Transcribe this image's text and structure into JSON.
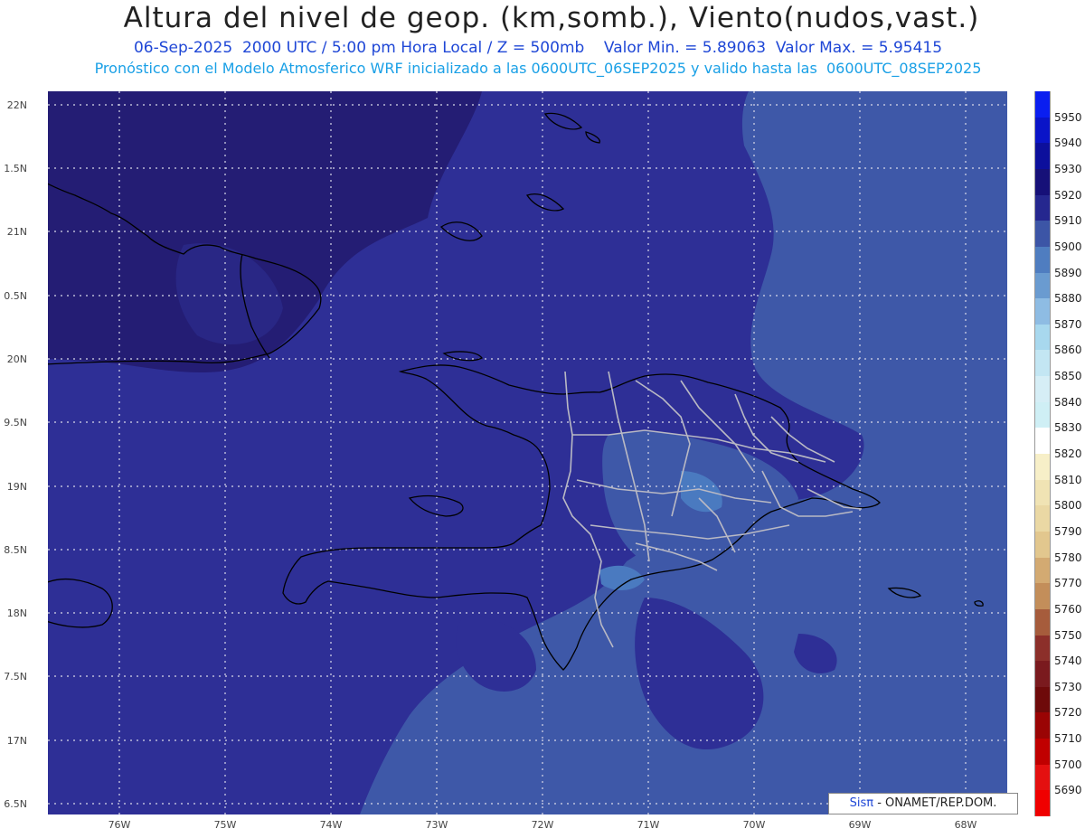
{
  "title": "Altura del nivel de geop. (km,somb.), Viento(nudos,vast.)",
  "subtitle_line1": "06-Sep-2025  2000 UTC / 5:00 pm Hora Local / Z = 500mb    Valor Min. = 5.89063  Valor Max. = 5.95415",
  "subtitle_line2": "Pronóstico con el Modelo Atmosferico WRF inicializado a las 0600UTC_06SEP2025 y valido hasta las  0600UTC_08SEP2025",
  "y_axis_labels": [
    "22N",
    "1.5N",
    "21N",
    "0.5N",
    "20N",
    "9.5N",
    "19N",
    "8.5N",
    "18N",
    "7.5N",
    "17N",
    "6.5N"
  ],
  "x_axis_labels": [
    "76W",
    "75W",
    "74W",
    "73W",
    "72W",
    "71W",
    "70W",
    "69W",
    "68W"
  ],
  "credit": {
    "brand": "Sisπ",
    "text": " - ONAMET/REP.DOM."
  },
  "colorbar": {
    "labels": [
      "5950",
      "5940",
      "5930",
      "5920",
      "5910",
      "5900",
      "5890",
      "5880",
      "5870",
      "5860",
      "5850",
      "5840",
      "5830",
      "5820",
      "5810",
      "5800",
      "5790",
      "5780",
      "5770",
      "5760",
      "5750",
      "5740",
      "5730",
      "5720",
      "5710",
      "5700",
      "5690"
    ],
    "colors": [
      "#0a1ef0",
      "#0a14c8",
      "#0c0f9c",
      "#161078",
      "#25278f",
      "#3c55a6",
      "#4f7dc0",
      "#6a9bd0",
      "#8ebce3",
      "#a8d8ee",
      "#c3e6f3",
      "#d6eef6",
      "#cfeff5",
      "#ffffff",
      "#f7efc8",
      "#f0e3b4",
      "#ead8a4",
      "#e2c78e",
      "#d3aa72",
      "#c38e5a",
      "#a65c3c",
      "#8c2f2a",
      "#7a1a1e",
      "#6e0a0a",
      "#9a0404",
      "#c00000",
      "#e41010",
      "#f00000"
    ]
  },
  "colors": {
    "deep": "#241d74",
    "mid": "#2e2f96",
    "light": "#3e58a8",
    "pale": "#4a7ac0",
    "coast": "#000000",
    "border": "#b9b9c4",
    "grid": "#d8d8e8"
  }
}
